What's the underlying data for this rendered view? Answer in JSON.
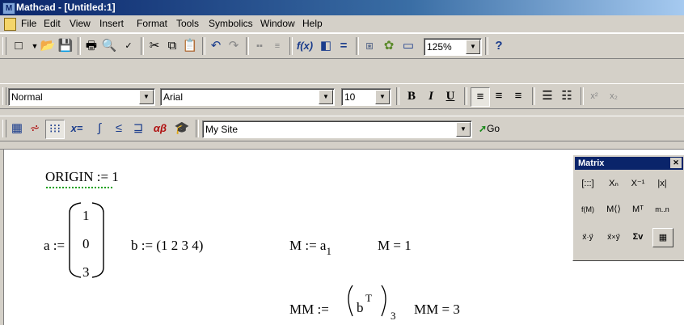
{
  "window": {
    "title": "Mathcad - [Untitled:1]",
    "app_icon": "mathcad-icon"
  },
  "menu": [
    "File",
    "Edit",
    "View",
    "Insert",
    "Format",
    "Tools",
    "Symbolics",
    "Window",
    "Help"
  ],
  "standard_toolbar": {
    "zoom": "125%"
  },
  "formatting_toolbar": {
    "style": "Normal",
    "font": "Arial",
    "size": "10",
    "bold": "B",
    "italic": "I",
    "underline": "U"
  },
  "web_toolbar": {
    "site": "My Site",
    "go_label": "Go",
    "xequals": "x=",
    "greek": "αβ"
  },
  "matrix_palette": {
    "title": "Matrix",
    "buttons": [
      "[:::]",
      "Xₙ",
      "X⁻¹",
      "|x|",
      "f(M)",
      "M⟨⟩",
      "Mᵀ",
      "m..n",
      "x⃗·y⃗",
      "x⃗×y⃗",
      "Σv",
      "▦"
    ]
  },
  "worksheet": {
    "origin_label": "ORIGIN",
    "origin_assign": ":= 1",
    "a_lhs": "a :=",
    "a_values": [
      "1",
      "0",
      "3"
    ],
    "b_def": "b := (1  2  3  4)",
    "M_def_lhs": "M := a",
    "M_def_sub": "1",
    "M_eval": "M = 1",
    "MM_def_lhs": "MM :=",
    "MM_inner": "b",
    "MM_sup": "T",
    "MM_sub": "3",
    "MM_eval": "MM = 3"
  }
}
